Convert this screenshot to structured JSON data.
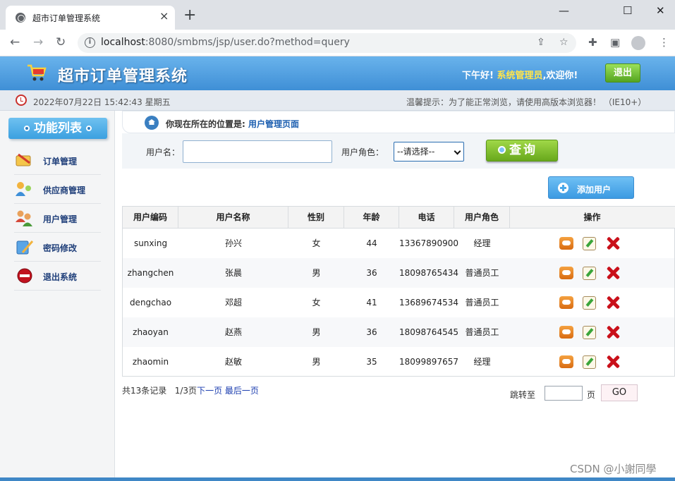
{
  "browser": {
    "tab_title": "超市订单管理系统",
    "tab_close": "×",
    "new_tab": "+",
    "minimize": "—",
    "maximize": "☐",
    "close": "✕",
    "url_host": "localhost",
    "url_rest": ":8080/smbms/jsp/user.do?method=query",
    "back": "←",
    "forward": "→",
    "reload": "↻",
    "info_glyph": "i",
    "share_icon": "⇪",
    "star_icon": "☆",
    "extensions_icon": "✚",
    "sidebar_icon": "▣",
    "menu_icon": "⋮"
  },
  "header": {
    "title": "超市订单管理系统",
    "greeting": "下午好!",
    "user_role": "系统管理员",
    "welcome": ",欢迎你!",
    "logout_label": "退出"
  },
  "infobar": {
    "datetime": "2022年07月22日 15:42:43 星期五",
    "tip": "温馨提示：为了能正常浏览，请使用高版本浏览器！ （IE10+）"
  },
  "sidebar": {
    "title": "功能列表",
    "items": [
      {
        "label": "订单管理",
        "icon": "order-icon"
      },
      {
        "label": "供应商管理",
        "icon": "supplier-icon"
      },
      {
        "label": "用户管理",
        "icon": "users-icon"
      },
      {
        "label": "密码修改",
        "icon": "password-icon"
      },
      {
        "label": "退出系统",
        "icon": "exit-icon"
      }
    ]
  },
  "breadcrumb": {
    "prefix": "你现在所在的位置是:",
    "current": "用户管理页面"
  },
  "search": {
    "username_label": "用户名：",
    "username_value": "",
    "role_label": "用户角色：",
    "role_selected": "--请选择--",
    "query_label": "查询"
  },
  "actions": {
    "add_user_label": "添加用户"
  },
  "table": {
    "columns": [
      "用户编码",
      "用户名称",
      "性别",
      "年龄",
      "电话",
      "用户角色",
      "操作"
    ],
    "rows": [
      [
        "sunxing",
        "孙兴",
        "女",
        "44",
        "13367890900",
        "经理"
      ],
      [
        "zhangchen",
        "张晨",
        "男",
        "36",
        "18098765434",
        "普通员工"
      ],
      [
        "dengchao",
        "邓超",
        "女",
        "41",
        "13689674534",
        "普通员工"
      ],
      [
        "zhaoyan",
        "赵燕",
        "男",
        "36",
        "18098764545",
        "普通员工"
      ],
      [
        "zhaomin",
        "赵敏",
        "男",
        "35",
        "18099897657",
        "经理"
      ]
    ]
  },
  "pager": {
    "total": "共13条记录",
    "current": "1/3页",
    "next": "下一页",
    "last": "最后一页",
    "goto_label": "跳转至",
    "page_value": "",
    "page_unit": "页",
    "go_label": "GO"
  },
  "watermark": "CSDN @小謝同學",
  "colors": {
    "header_blue": "#3f8fd6",
    "accent_green": "#68a81c",
    "role_yellow": "#ffe44a",
    "link_blue": "#1d3fb0"
  }
}
